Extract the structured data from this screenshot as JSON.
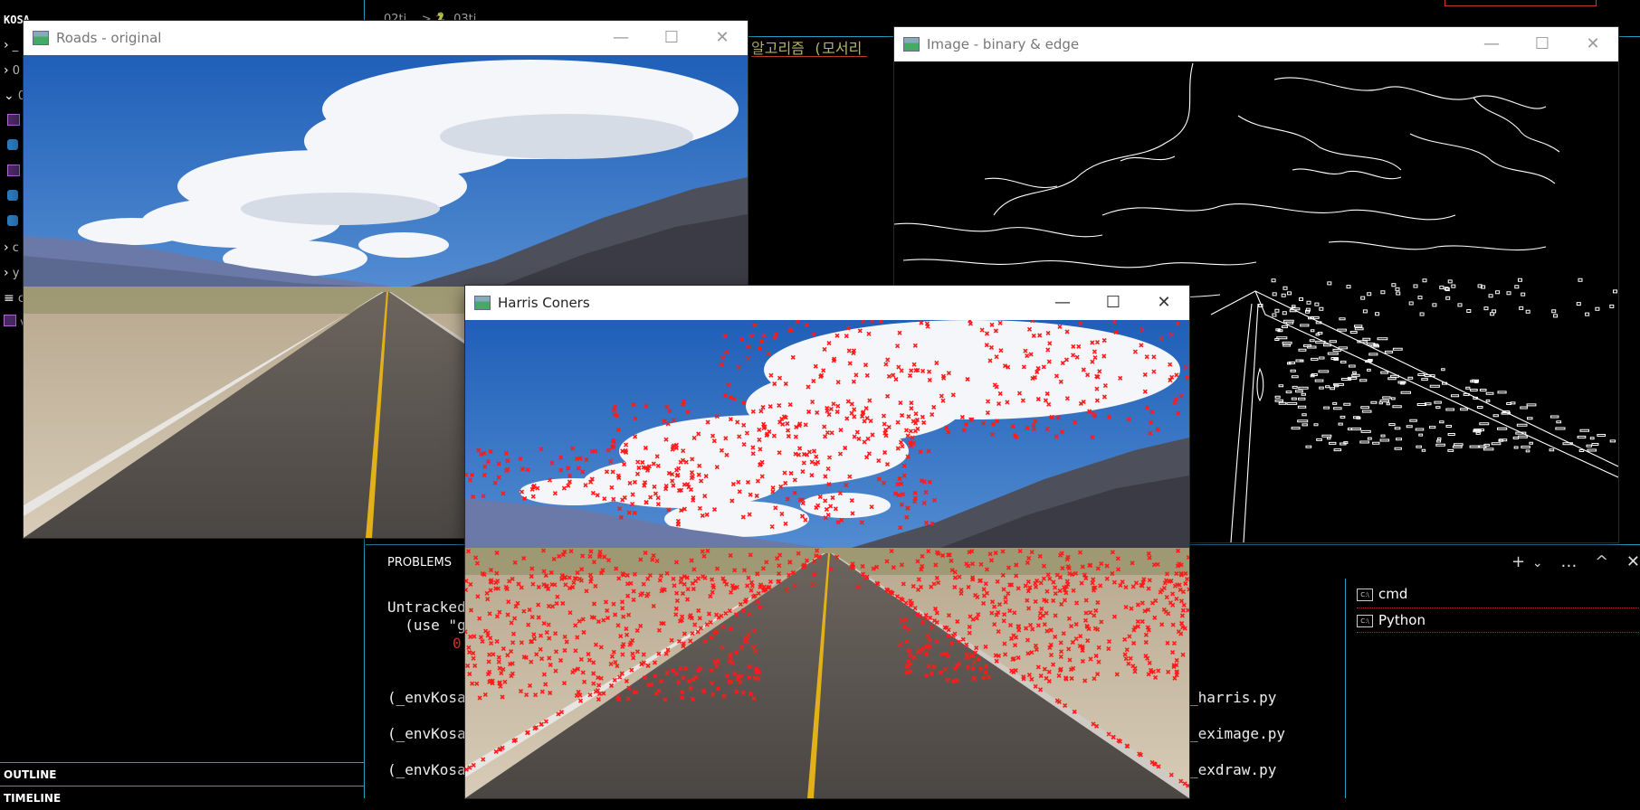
{
  "explorer": {
    "root_label": "KOSA",
    "rows": [
      {
        "chev": "›",
        "label": "_"
      },
      {
        "chev": "›",
        "label": "0"
      },
      {
        "chev": "⌄",
        "label": "0"
      },
      {
        "chev": "›",
        "label": "c"
      },
      {
        "chev": "›",
        "label": "y"
      },
      {
        "chev": "≡",
        "label": "c"
      },
      {
        "chev": "",
        "label": "v"
      }
    ],
    "outline_label": "OUTLINE",
    "timeline_label": "TIMELINE"
  },
  "editor": {
    "breadcrumb": "02ti... > 🐍 03ti...",
    "korean_text": "알고리즘 (모서리"
  },
  "panel": {
    "tab_label": "PROBLEMS",
    "lines": [
      "Untracked",
      "  (use \"g",
      "(_envKosa",
      "(_envKosa",
      "(_envKosa"
    ],
    "red_fragment": "0",
    "right_lines": [
      "_harris.py",
      "_eximage.py",
      "_exdraw.py"
    ],
    "actions": [
      "+",
      "⌄",
      "…",
      "^",
      "✕"
    ]
  },
  "terminals": [
    {
      "icon": "C:\\",
      "label": "cmd"
    },
    {
      "icon": "C:\\",
      "label": "Python"
    }
  ],
  "windows": {
    "original": {
      "title": "Roads - original"
    },
    "edge": {
      "title": "Image - binary & edge"
    },
    "harris": {
      "title": "Harris Coners"
    }
  },
  "window_controls": {
    "minimize": "—",
    "maximize": "☐",
    "close": "✕"
  },
  "colors": {
    "accent_border": "#2aa0c8",
    "corner_marker": "#ff1a1a",
    "korean_text": "#b7b36a"
  }
}
